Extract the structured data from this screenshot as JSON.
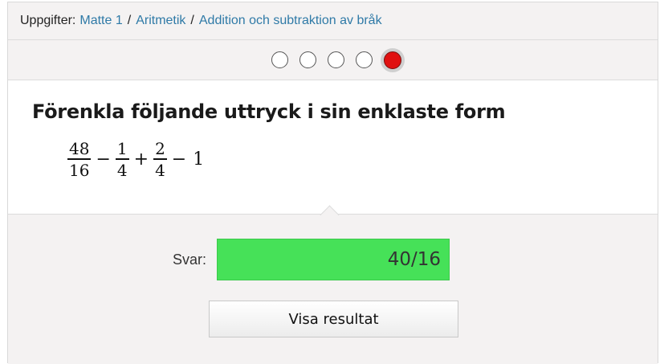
{
  "breadcrumb": {
    "label": "Uppgifter:",
    "items": [
      "Matte 1",
      "Aritmetik",
      "Addition och subtraktion av bråk"
    ],
    "separator": "/"
  },
  "progress": {
    "total": 5,
    "current": 5,
    "active_color": "#e01111"
  },
  "question": {
    "title": "Förenkla följande uttryck i sin enklaste form",
    "expression": {
      "terms": [
        {
          "num": "48",
          "den": "16"
        },
        {
          "op": "−"
        },
        {
          "num": "1",
          "den": "4"
        },
        {
          "op": "+"
        },
        {
          "num": "2",
          "den": "4"
        },
        {
          "op": "−"
        },
        {
          "value": "1"
        }
      ]
    }
  },
  "answer": {
    "label": "Svar:",
    "value": "40/16",
    "status_color": "#46e158"
  },
  "result_button": {
    "label": "Visa resultat"
  }
}
